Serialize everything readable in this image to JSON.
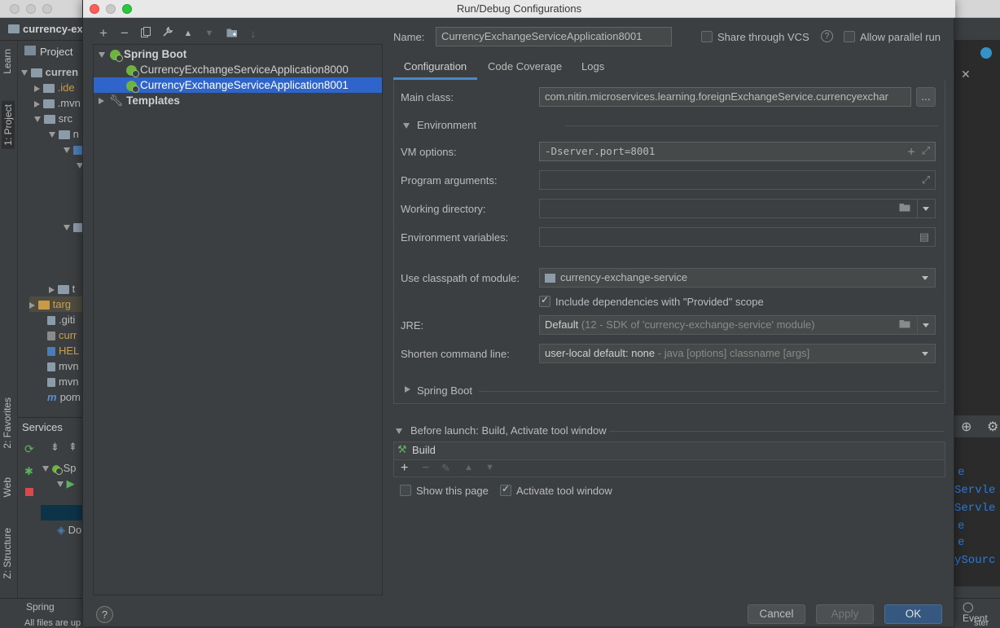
{
  "ide": {
    "project_name": "currency-ex",
    "project_dropdown": "Project",
    "tree_root": "curren",
    "tree_items": [
      ".ide",
      ".mvn",
      "src",
      "n",
      "t",
      "targ",
      ".giti",
      "curr",
      "HEL",
      "mvn",
      "mvn",
      "pom"
    ],
    "services_title": "Services",
    "services_items": [
      "Sp",
      "Do"
    ],
    "strip_tabs": [
      "Learn",
      "1: Project",
      "2: Favorites",
      "Web",
      "Z: Structure"
    ],
    "status_spring": "Spring",
    "status_text": "All files are up",
    "status_right": "Event",
    "status_right2": "ster",
    "console_lines": [
      "e",
      "Servle",
      "Servle",
      "e",
      "e",
      "ySourc"
    ]
  },
  "dialog": {
    "title": "Run/Debug Configurations",
    "toolbar": {
      "add": "+",
      "remove": "−",
      "copy": "⧉",
      "edit": "🔧",
      "up": "▲",
      "down": "▼",
      "folder": "📁",
      "sort": "↓"
    },
    "tree": {
      "spring_boot": "Spring Boot",
      "app_8000": "CurrencyExchangeServiceApplication8000",
      "app_8001": "CurrencyExchangeServiceApplication8001",
      "templates": "Templates"
    },
    "help": "?",
    "name_label": "Name:",
    "name_value": "CurrencyExchangeServiceApplication8001",
    "share_vcs": "Share through VCS",
    "allow_parallel": "Allow parallel run",
    "tabs": [
      "Configuration",
      "Code Coverage",
      "Logs"
    ],
    "main_class_label": "Main class:",
    "main_class_value": "com.nitin.microservices.learning.foreignExchangeService.currencyexchar",
    "more_btn": "...",
    "environment_label": "Environment",
    "vm_options_label": "VM options:",
    "vm_options_value": "-Dserver.port=8001",
    "program_args_label": "Program arguments:",
    "working_dir_label": "Working directory:",
    "env_vars_label": "Environment variables:",
    "classpath_label": "Use classpath of module:",
    "classpath_value": "currency-exchange-service",
    "include_deps": "Include dependencies with \"Provided\" scope",
    "jre_label": "JRE:",
    "jre_value": "Default",
    "jre_hint": "(12 - SDK of 'currency-exchange-service' module)",
    "shorten_label": "Shorten command line:",
    "shorten_value": "user-local default: none",
    "shorten_hint": "- java [options] classname [args]",
    "spring_boot_section": "Spring Boot",
    "before_launch": "Before launch: Build, Activate tool window",
    "build_item": "Build",
    "show_page": "Show this page",
    "activate_tool": "Activate tool window",
    "cancel": "Cancel",
    "apply": "Apply",
    "ok": "OK"
  },
  "colors": {
    "accent": "#4a88c7",
    "selection": "#2f65ca",
    "spring_green": "#6db33f"
  }
}
